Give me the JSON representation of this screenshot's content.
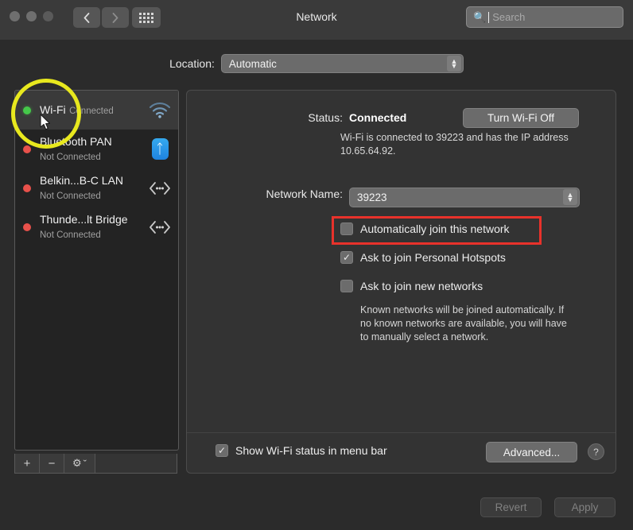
{
  "window": {
    "title": "Network",
    "traffic_lights": [
      "close",
      "minimize",
      "zoom"
    ],
    "nav": {
      "back_icon": "chevron-left-icon",
      "forward_icon": "chevron-right-icon",
      "grid_icon": "grid-apps-icon"
    },
    "search": {
      "placeholder": "Search",
      "icon": "search-icon"
    }
  },
  "location": {
    "label": "Location:",
    "value": "Automatic"
  },
  "sidebar": {
    "items": [
      {
        "name": "Wi-Fi",
        "status": "Connected",
        "dot": "green",
        "icon": "wifi-icon",
        "selected": true
      },
      {
        "name": "Bluetooth PAN",
        "status": "Not Connected",
        "dot": "red",
        "icon": "bluetooth-icon",
        "selected": false
      },
      {
        "name": "Belkin...B-C LAN",
        "status": "Not Connected",
        "dot": "red",
        "icon": "ethernet-icon",
        "selected": false
      },
      {
        "name": "Thunde...lt Bridge",
        "status": "Not Connected",
        "dot": "red",
        "icon": "ethernet-icon",
        "selected": false
      }
    ],
    "footer": {
      "add_label": "+",
      "remove_label": "−",
      "gear_label": "⚙",
      "gear_chevron": "ˇ"
    }
  },
  "main": {
    "status_label": "Status:",
    "status_value": "Connected",
    "turn_off_label": "Turn Wi-Fi Off",
    "status_description": "Wi-Fi is connected to 39223 and has the IP address 10.65.64.92.",
    "network_name_label": "Network Name:",
    "network_name_value": "39223",
    "checkboxes": [
      {
        "label": "Automatically join this network",
        "checked": false,
        "highlighted": true
      },
      {
        "label": "Ask to join Personal Hotspots",
        "checked": true,
        "highlighted": false
      },
      {
        "label": "Ask to join new networks",
        "checked": false,
        "highlighted": false
      }
    ],
    "note": "Known networks will be joined automatically. If no known networks are available, you will have to manually select a network.",
    "show_status_label": "Show Wi-Fi status in menu bar",
    "show_status_checked": true,
    "advanced_label": "Advanced...",
    "help_label": "?"
  },
  "footer": {
    "revert_label": "Revert",
    "apply_label": "Apply"
  },
  "annotations": {
    "ring_color": "#e8e81e",
    "redbox_color": "#e8322b"
  },
  "colors": {
    "window_bg": "#2b2b2b",
    "panel_bg": "#333333",
    "sidebar_bg": "#232323",
    "selected_row": "#3a3a3a",
    "connected_dot": "#45c84a",
    "disconnected_dot": "#e8514b",
    "bluetooth_blue": "#1f83e0"
  }
}
